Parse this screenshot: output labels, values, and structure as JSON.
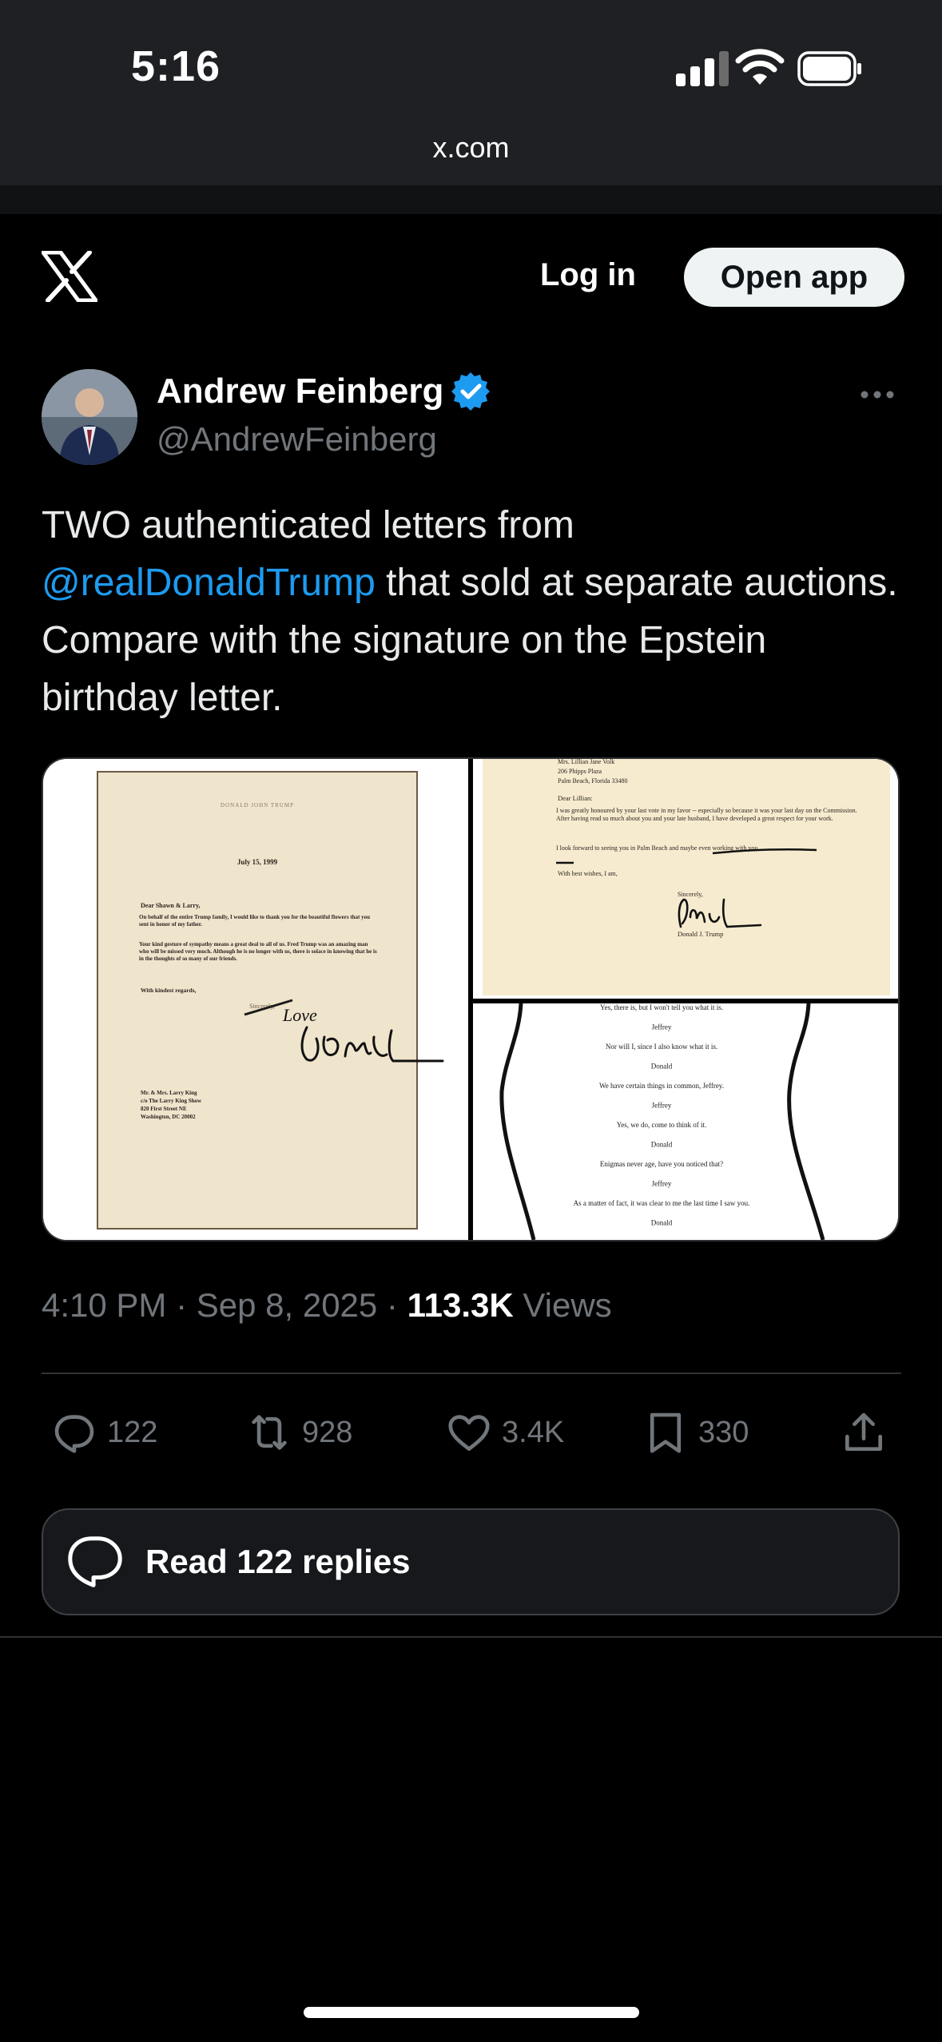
{
  "status_bar": {
    "time": "5:16"
  },
  "browser": {
    "url": "x.com"
  },
  "header": {
    "login_label": "Log in",
    "open_app_label": "Open app"
  },
  "tweet": {
    "author_name": "Andrew Feinberg",
    "author_handle": "@AndrewFeinberg",
    "text_part1": "TWO authenticated letters from ",
    "mention": "@realDonaldTrump",
    "text_part2": " that sold at separate auctions. Compare with the signature on the Epstein birthday letter.",
    "timestamp": "4:10 PM · Sep 8, 2025 · ",
    "views_count": "113.3K",
    "views_label": " Views",
    "media": {
      "letter1": {
        "letterhead": "DONALD JOHN TRUMP",
        "date": "July 15, 1999",
        "salutation": "Dear Shawn & Larry,",
        "body1": "On behalf of the entire Trump family, I would like to thank you for the beautiful flowers that you sent in honor of my father.",
        "body2": "Your kind gesture of sympathy means a great deal to all of us. Fred Trump was an amazing man who will be missed very much. Although he is no longer with us, there is solace in knowing that he is in the thoughts of so many of our friends.",
        "closing": "With kindest regards,",
        "sincerely": "Sincerely,",
        "handwritten_love": "Love",
        "addr1": "Mr. & Mrs. Larry King",
        "addr2": "c/o The Larry King Show",
        "addr3": "820 First Street NE",
        "addr4": "Washington, DC 20002"
      },
      "letter2": {
        "addr1": "Mrs. Lillian Jane Volk",
        "addr2": "206 Phipps Plaza",
        "addr3": "Palm Beach, Florida 33480",
        "salutation": "Dear Lillian:",
        "body1": "I was greatly honoured by your last vote in my favor -- especially so because it was your last day on the Commission. After having read so much about you and your late husband, I have developed a great respect for your work.",
        "body2": "I look forward to seeing you in Palm Beach and maybe even working with you.",
        "closing": "With best wishes, I am,",
        "sincerely": "Sincerely,",
        "signer": "Donald J. Trump"
      },
      "letter3": {
        "lines": [
          "Yes, there is, but I won't tell you what it is.",
          "Jeffrey",
          "Nor will I, since I also know what it is.",
          "Donald",
          "We have certain things in common, Jeffrey.",
          "Jeffrey",
          "Yes, we do, come to think of it.",
          "Donald",
          "Enigmas never age, have you noticed that?",
          "Jeffrey",
          "As a matter of fact, it was clear to me the last time I saw you.",
          "Donald"
        ]
      }
    },
    "actions": {
      "replies": "122",
      "reposts": "928",
      "likes": "3.4K",
      "bookmarks": "330"
    },
    "read_replies_label": "Read 122 replies"
  },
  "icons": {
    "x_logo": "x-logo-icon",
    "verified": "verified-badge-icon",
    "more": "more-icon",
    "reply": "reply-icon",
    "repost": "repost-icon",
    "like": "heart-icon",
    "bookmark": "bookmark-icon",
    "share": "share-icon",
    "chat": "chat-bubbles-icon"
  },
  "colors": {
    "background": "#000000",
    "accent": "#1d9bf0",
    "muted": "#71767b",
    "border": "#2f3336"
  }
}
